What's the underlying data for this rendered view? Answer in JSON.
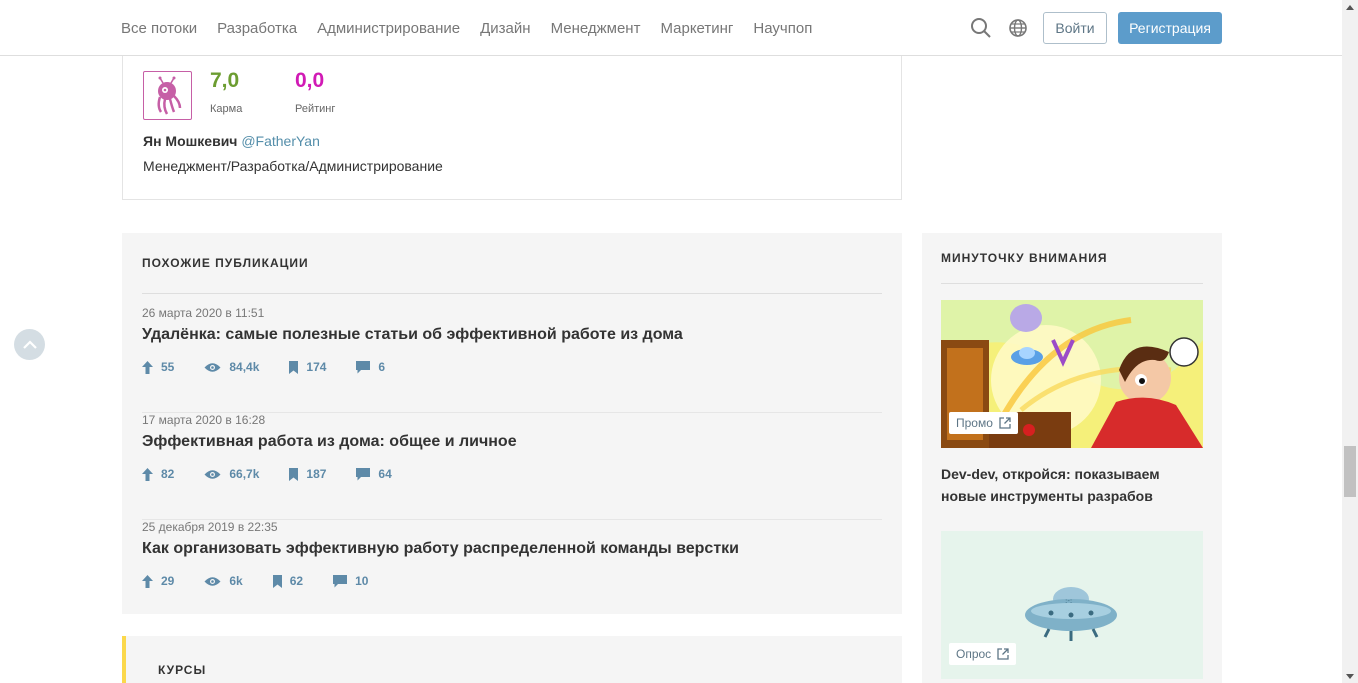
{
  "nav": {
    "links": [
      "Все потоки",
      "Разработка",
      "Администрирование",
      "Дизайн",
      "Менеджмент",
      "Маркетинг",
      "Научпоп"
    ],
    "login_label": "Войти",
    "register_label": "Регистрация",
    "icons": [
      "search-icon",
      "globe-icon"
    ]
  },
  "author": {
    "karma_value": "7,0",
    "karma_label": "Карма",
    "rating_value": "0,0",
    "rating_label": "Рейтинг",
    "name": "Ян Мошкевич",
    "nick": "@FatherYan",
    "specialization": "Менеджмент/Разработка/Администрирование",
    "colors": {
      "karma": "#6c9d31",
      "rating": "#d11ab5"
    }
  },
  "similar": {
    "title": "Похожие публикации",
    "posts": [
      {
        "date": "26 марта 2020 в 11:51",
        "title": "Удалёнка: самые полезные статьи об эффективной работе из дома",
        "votes": "55",
        "views": "84,4k",
        "bookmarks": "174",
        "comments": "6"
      },
      {
        "date": "17 марта 2020 в 16:28",
        "title": "Эффективная работа из дома: общее и личное",
        "votes": "82",
        "views": "66,7k",
        "bookmarks": "187",
        "comments": "64"
      },
      {
        "date": "25 декабря 2019 в 22:35",
        "title": "Как организовать эффективную работу распределенной команды верстки",
        "votes": "29",
        "views": "6k",
        "bookmarks": "62",
        "comments": "10"
      }
    ]
  },
  "courses": {
    "title": "Курсы"
  },
  "sidebar": {
    "title": "Минуточку внимания",
    "promo_badge": "Промо",
    "promo_title": "Dev-dev, откройся: показываем новые инструменты разрабов",
    "poll_badge": "Опрос"
  }
}
